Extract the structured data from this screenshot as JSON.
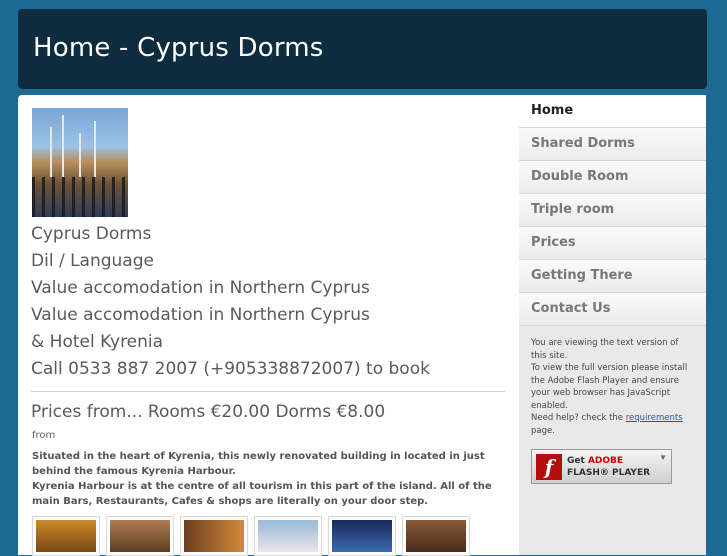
{
  "header": {
    "title": "Home - Cyprus Dorms"
  },
  "main": {
    "lines": [
      "Cyprus Dorms",
      "Dil / Language",
      "Value accomodation in Northern Cyprus",
      "Value accomodation in Northern Cyprus",
      "& Hotel Kyrenia",
      "Call 0533 887 2007 (+905338872007) to book"
    ],
    "prices": "Prices from... Rooms €20.00 Dorms €8.00",
    "from": "from",
    "desc_1": "Situated in the heart of Kyrenia, this newly renovated building in located in just behind the famous Kyrenia Harbour.",
    "desc_2": "Kyrenia Harbour is at the centre of all tourism in this part of the island. All of the main Bars, Restaurants, Cafes & shops are literally on your door step."
  },
  "sidebar": {
    "items": [
      {
        "label": "Home",
        "active": true
      },
      {
        "label": "Shared Dorms"
      },
      {
        "label": "Double Room"
      },
      {
        "label": "Triple room"
      },
      {
        "label": "Prices"
      },
      {
        "label": "Getting There"
      },
      {
        "label": "Contact Us"
      }
    ],
    "note_1": "You are viewing the text version of this site.",
    "note_2": "To view the full version please install the Adobe Flash Player and ensure your web browser has JavaScript enabled.",
    "note_3_pre": "Need help? check the",
    "note_3_link": "requirements",
    "note_3_post": "page.",
    "flash_get": "Get",
    "flash_adobe": "ADOBE",
    "flash_player": "FLASH® PLAYER",
    "flash_logo": "f"
  },
  "colors": {
    "background": "#1c6a94",
    "header_bg": "#0d2c3d",
    "sidebar_bg": "#e9e9e9"
  }
}
